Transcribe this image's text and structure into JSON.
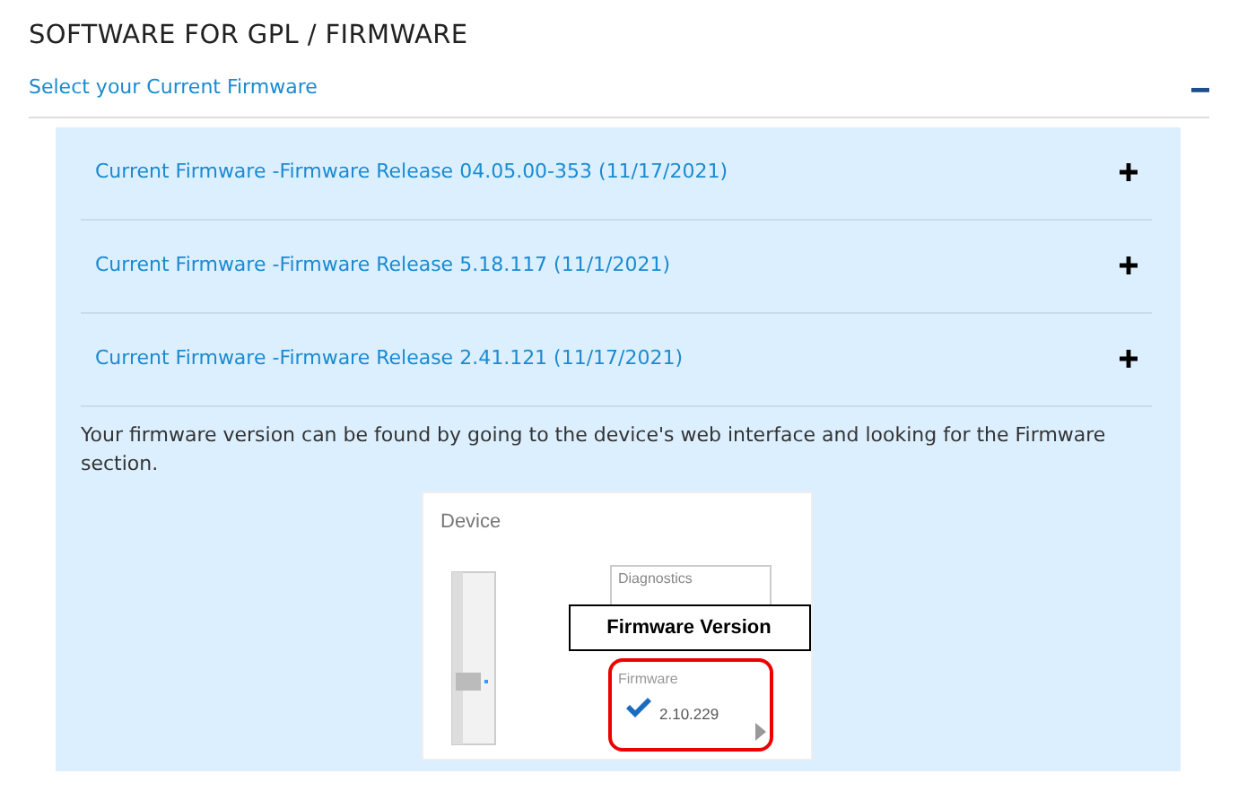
{
  "title": "SOFTWARE FOR GPL / FIRMWARE",
  "section": {
    "label": "Select your Current Firmware",
    "expanded": true
  },
  "items": [
    {
      "label": "Current Firmware -Firmware Release 04.05.00-353 (11/17/2021)",
      "expanded": false
    },
    {
      "label": "Current Firmware -Firmware Release 5.18.117 (11/1/2021)",
      "expanded": false
    },
    {
      "label": "Current Firmware -Firmware Release 2.41.121 (11/17/2021)",
      "expanded": false
    }
  ],
  "note": "Your firmware version can be found by going to the device's web interface and looking for the Firmware section.",
  "screenshot": {
    "panel_title": "Device",
    "diagnostics_label": "Diagnostics",
    "callout": "Firmware Version",
    "firmware_label": "Firmware",
    "firmware_version": "2.10.229"
  }
}
